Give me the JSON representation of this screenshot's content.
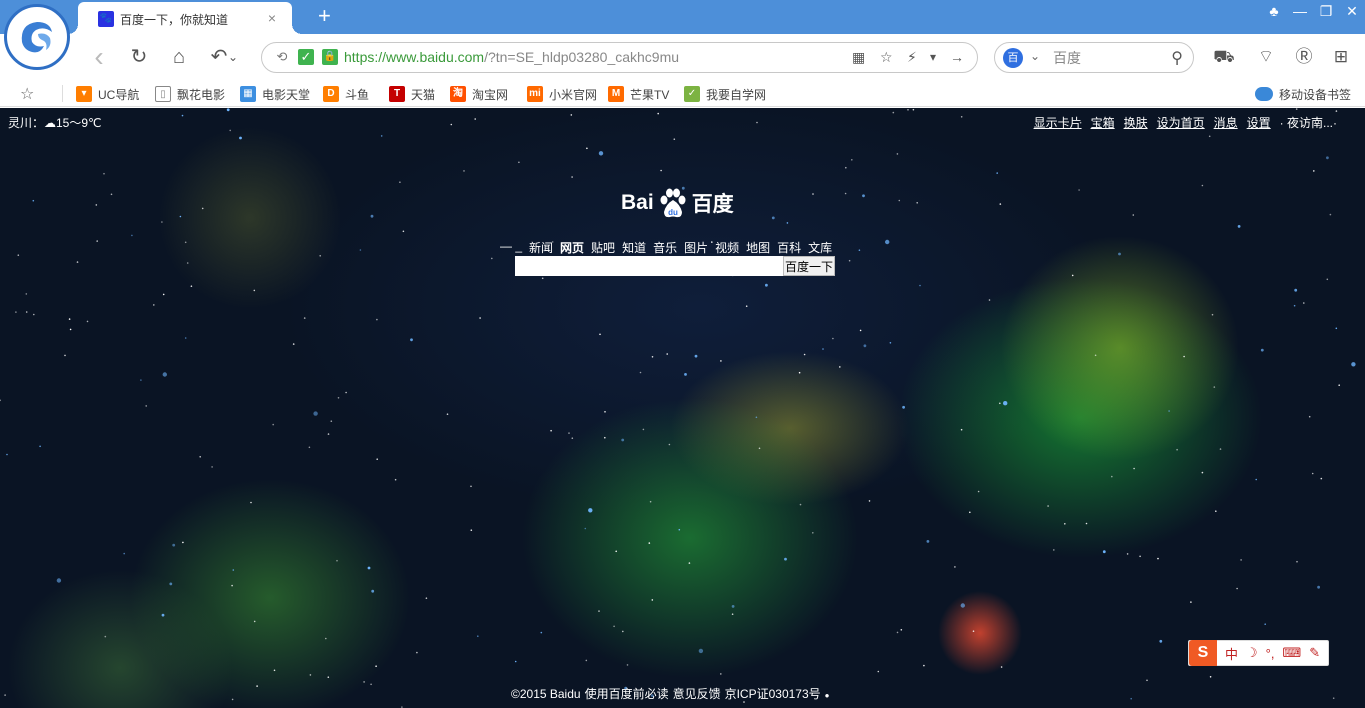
{
  "tab": {
    "title": "百度一下，你就知道",
    "close": "×"
  },
  "titlebar": {
    "new_tab": "+",
    "skin": "♣",
    "minimize": "—",
    "restore": "❐",
    "close": "✕"
  },
  "navbar": {
    "back": "‹",
    "refresh": "↻",
    "home": "⌂",
    "undo": "↶",
    "undo_caret": "⌄",
    "url_https": "https://www.",
    "url_domain": "baidu.com",
    "url_rest": "/?tn=SE_hldp03280_cakhc9mu",
    "qr": "▦",
    "star": "☆",
    "flash": "⚡",
    "caret": "▾",
    "go": "→"
  },
  "search": {
    "engine_glyph": "百",
    "caret": "⌄",
    "placeholder": "百度",
    "icon": "⚲"
  },
  "tools": {
    "car": "⛟",
    "wifi": "⌔",
    "shield": "Ⓡ",
    "apps": "⊞"
  },
  "bookmarks": {
    "items": [
      {
        "label": "UC导航",
        "icon": "▾",
        "color": "#ff7e00"
      },
      {
        "label": "飘花电影",
        "icon": "▯",
        "color": "#ffffff"
      },
      {
        "label": "电影天堂",
        "icon": "▦",
        "color": "#3d8fe0"
      },
      {
        "label": "斗鱼",
        "icon": "D",
        "color": "#ff7e00"
      },
      {
        "label": "天猫",
        "icon": "T",
        "color": "#c40000"
      },
      {
        "label": "淘宝网",
        "icon": "淘",
        "color": "#ff5000"
      },
      {
        "label": "小米官网",
        "icon": "mi",
        "color": "#ff6900"
      },
      {
        "label": "芒果TV",
        "icon": "M",
        "color": "#ff6a00"
      },
      {
        "label": "我要自学网",
        "icon": "✓",
        "color": "#7cb342"
      }
    ],
    "right_label": "移动设备书签"
  },
  "page": {
    "weather": "灵川：☁15～9℃",
    "top_links": [
      "显示卡片",
      "宝箱",
      "换肤",
      "设为首页",
      "消息",
      "设置"
    ],
    "top_links_extra": "· 夜访南...·",
    "logo_left": "Bai",
    "logo_right": "百度",
    "nav_links": [
      {
        "label": "— _",
        "active": false
      },
      {
        "label": "新闻",
        "active": false
      },
      {
        "label": "网页",
        "active": true
      },
      {
        "label": "贴吧",
        "active": false
      },
      {
        "label": "知道",
        "active": false
      },
      {
        "label": "音乐",
        "active": false
      },
      {
        "label": "图片",
        "active": false
      },
      {
        "label": "视频",
        "active": false
      },
      {
        "label": "地图",
        "active": false
      },
      {
        "label": "百科",
        "active": false
      },
      {
        "label": "文库",
        "active": false
      }
    ],
    "search_button": "百度一下",
    "footer": [
      "©2015 Baidu",
      "使用百度前必读",
      "意见反馈",
      "京ICP证030173号"
    ],
    "footer_icon": "●"
  },
  "ime": {
    "logo": "S",
    "items": [
      "中",
      "☽",
      "°,",
      "⌨",
      "✎"
    ]
  }
}
